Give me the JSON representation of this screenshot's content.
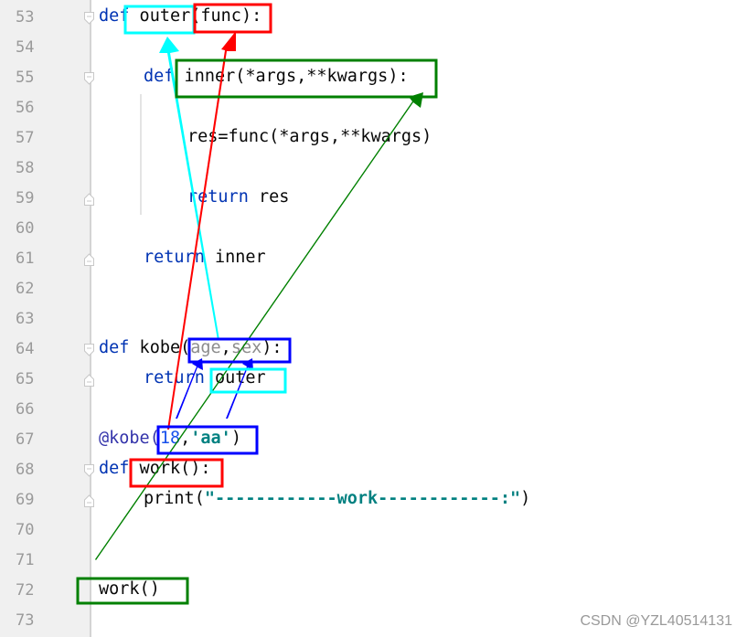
{
  "editor": {
    "lines": [
      {
        "number": "53",
        "tokens": [
          {
            "t": "def",
            "c": "kw"
          },
          {
            "t": " outer(func):",
            "c": "fn"
          }
        ],
        "indent": 0,
        "fold": "open"
      },
      {
        "number": "54",
        "tokens": [],
        "indent": 0
      },
      {
        "number": "55",
        "tokens": [
          {
            "t": "def",
            "c": "kw"
          },
          {
            "t": " inner(*args,**kwargs):",
            "c": "fn"
          }
        ],
        "indent": 1,
        "fold": "open"
      },
      {
        "number": "56",
        "tokens": [],
        "indent": 0
      },
      {
        "number": "57",
        "tokens": [
          {
            "t": "res=func(*args,**kwargs)",
            "c": "fn"
          }
        ],
        "indent": 2
      },
      {
        "number": "58",
        "tokens": [],
        "indent": 0
      },
      {
        "number": "59",
        "tokens": [
          {
            "t": "return",
            "c": "kw"
          },
          {
            "t": " res",
            "c": "fn"
          }
        ],
        "indent": 2,
        "fold": "close"
      },
      {
        "number": "60",
        "tokens": [],
        "indent": 0
      },
      {
        "number": "61",
        "tokens": [
          {
            "t": "return",
            "c": "kw"
          },
          {
            "t": " inner",
            "c": "fn"
          }
        ],
        "indent": 1,
        "fold": "close"
      },
      {
        "number": "62",
        "tokens": [],
        "indent": 0
      },
      {
        "number": "63",
        "tokens": [],
        "indent": 0
      },
      {
        "number": "64",
        "tokens": [
          {
            "t": "def",
            "c": "kw"
          },
          {
            "t": " kobe(",
            "c": "fn"
          },
          {
            "t": "age",
            "c": "param"
          },
          {
            "t": ",",
            "c": "fn"
          },
          {
            "t": "sex",
            "c": "param"
          },
          {
            "t": "):",
            "c": "fn"
          }
        ],
        "indent": 0,
        "fold": "open"
      },
      {
        "number": "65",
        "tokens": [
          {
            "t": "return",
            "c": "kw"
          },
          {
            "t": " outer",
            "c": "fn"
          }
        ],
        "indent": 1,
        "fold": "close"
      },
      {
        "number": "66",
        "tokens": [],
        "indent": 0
      },
      {
        "number": "67",
        "tokens": [
          {
            "t": "@kobe(",
            "c": "deco"
          },
          {
            "t": "18",
            "c": "num"
          },
          {
            "t": ",",
            "c": "fn"
          },
          {
            "t": "'aa'",
            "c": "str"
          },
          {
            "t": ")",
            "c": "fn"
          }
        ],
        "indent": 0
      },
      {
        "number": "68",
        "tokens": [
          {
            "t": "def",
            "c": "kw"
          },
          {
            "t": " work():",
            "c": "fn"
          }
        ],
        "indent": 0,
        "fold": "open"
      },
      {
        "number": "69",
        "tokens": [
          {
            "t": "print(",
            "c": "fn"
          },
          {
            "t": "\"------------work------------:\"",
            "c": "str"
          },
          {
            "t": ")",
            "c": "fn"
          }
        ],
        "indent": 1,
        "fold": "close"
      },
      {
        "number": "70",
        "tokens": [],
        "indent": 0
      },
      {
        "number": "71",
        "tokens": [],
        "indent": 0
      },
      {
        "number": "72",
        "tokens": [
          {
            "t": "work()",
            "c": "fn"
          }
        ],
        "indent": 0
      },
      {
        "number": "73",
        "tokens": [],
        "indent": 0
      }
    ]
  },
  "annotations": {
    "colors": {
      "cyan": "#00ffff",
      "red": "#ff0000",
      "green": "#008000",
      "blue": "#0000ff"
    },
    "boxes": [
      {
        "label": "outer-name-box",
        "color": "cyan",
        "target": "outer"
      },
      {
        "label": "func-param-box",
        "color": "red",
        "target": "(func):"
      },
      {
        "label": "inner-signature-box",
        "color": "green",
        "target": "inner(*args,**kwargs):"
      },
      {
        "label": "kobe-params-box",
        "color": "blue",
        "target": "(age,sex)"
      },
      {
        "label": "return-outer-box",
        "color": "cyan",
        "target": "outer"
      },
      {
        "label": "decorator-args-box",
        "color": "blue",
        "target": "(18,'aa')"
      },
      {
        "label": "work-def-box",
        "color": "red",
        "target": "work():"
      },
      {
        "label": "work-call-box",
        "color": "green",
        "target": "work()"
      }
    ]
  },
  "watermark": "CSDN @YZL40514131"
}
